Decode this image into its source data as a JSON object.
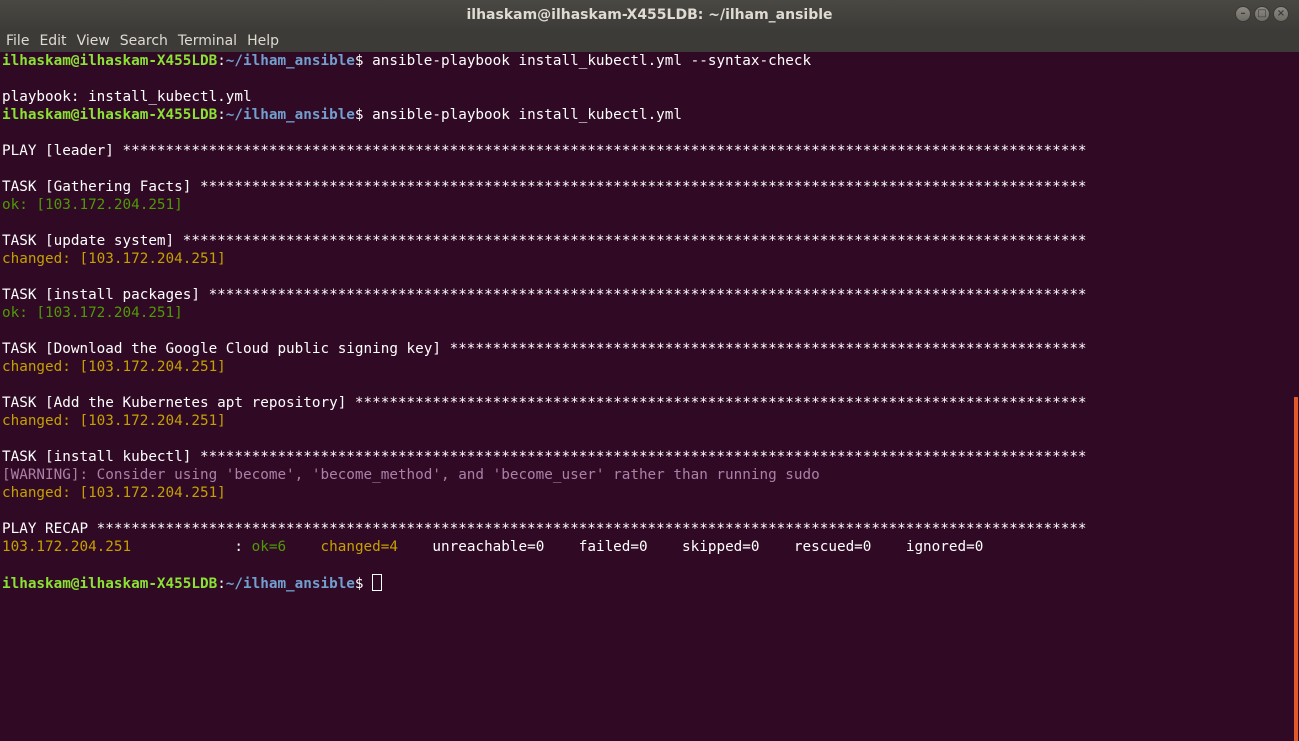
{
  "window": {
    "title": "ilhaskam@ilhaskam-X455LDB: ~/ilham_ansible"
  },
  "menu": [
    "File",
    "Edit",
    "View",
    "Search",
    "Terminal",
    "Help"
  ],
  "prompt": {
    "userhost": "ilhaskam@ilhaskam-X455LDB",
    "path": "~/ilham_ansible",
    "symbol": "$ "
  },
  "commands": {
    "first": "ansible-playbook install_kubectl.yml --syntax-check",
    "second": "ansible-playbook install_kubectl.yml"
  },
  "output": {
    "syntax_result": "playbook: install_kubectl.yml",
    "play": "PLAY [leader] ****************************************************************************************************************",
    "t1": "TASK [Gathering Facts] *******************************************************************************************************",
    "t1_res": "ok: [103.172.204.251]",
    "t2": "TASK [update system] *********************************************************************************************************",
    "t2_res": "changed: [103.172.204.251]",
    "t3": "TASK [install packages] ******************************************************************************************************",
    "t3_res": "ok: [103.172.204.251]",
    "t4": "TASK [Download the Google Cloud public signing key] **************************************************************************",
    "t4_res": "changed: [103.172.204.251]",
    "t5": "TASK [Add the Kubernetes apt repository] *************************************************************************************",
    "t5_res": "changed: [103.172.204.251]",
    "t6": "TASK [install kubectl] *******************************************************************************************************",
    "warning": "[WARNING]: Consider using 'become', 'become_method', and 'become_user' rather than running sudo",
    "t6_res": "changed: [103.172.204.251]",
    "recap": "PLAY RECAP *******************************************************************************************************************",
    "recap_host": "103.172.204.251",
    "recap_sep": "            : ",
    "recap_ok": "ok=6",
    "recap_changed": "changed=4",
    "recap_rest": "unreachable=0    failed=0    skipped=0    rescued=0    ignored=0"
  },
  "colors": {
    "background": "#300a24",
    "prompt_user": "#8ae234",
    "prompt_path": "#729fcf",
    "ok": "#4e9a06",
    "changed": "#c4a000",
    "warning": "#ad7fa8",
    "scrollbar": "#e05a2b"
  }
}
